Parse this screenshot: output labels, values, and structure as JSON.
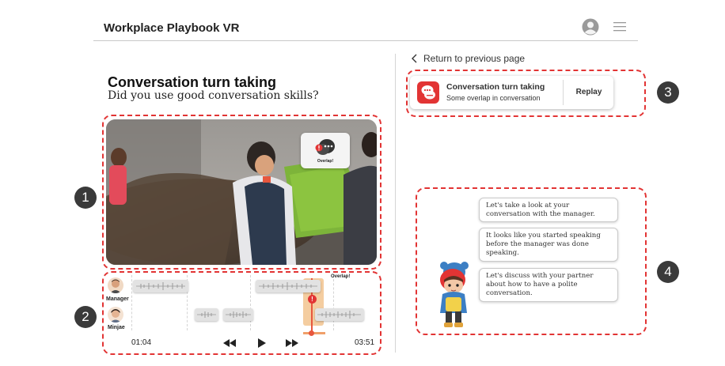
{
  "header": {
    "app_title": "Workplace Playbook VR"
  },
  "left": {
    "title": "Conversation turn taking",
    "subtitle": "Did you use good conversation skills?"
  },
  "video": {
    "popup_label": "Overlap!"
  },
  "timeline": {
    "speakers": [
      "Manager",
      "Minjae"
    ],
    "current_time": "01:04",
    "end_time": "03:51",
    "overlap_label": "Overlap!"
  },
  "markers": [
    "1",
    "2",
    "3",
    "4"
  ],
  "right": {
    "return_label": "Return to previous page",
    "feedback_card": {
      "title": "Conversation turn taking",
      "subtitle": "Some overlap in conversation",
      "replay_label": "Replay"
    },
    "agent_messages": [
      "Let's take a look at your conversation with the manager.",
      "It looks like you started speaking before the manager was done speaking.",
      "Let's discuss with your partner about how to have a polite conversation."
    ]
  },
  "colors": {
    "accent": "#e23434",
    "overlap_highlight": "#f3c896",
    "marker": "#3a3a3a"
  }
}
